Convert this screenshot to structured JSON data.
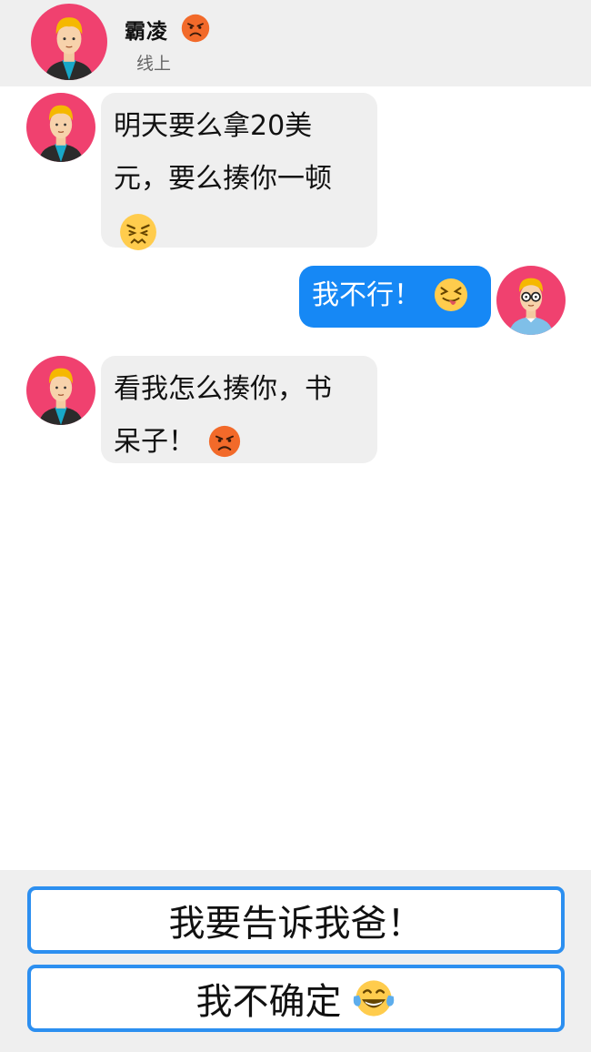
{
  "header": {
    "contact_name": "霸凌",
    "contact_name_emoji": "angry-face-icon",
    "status": "线上"
  },
  "messages": [
    {
      "side": "incoming",
      "avatar": "bully-avatar",
      "lines": [
        "明天要么拿20美",
        "元，要么揍你一顿"
      ],
      "emoji": "persevering-face-icon"
    },
    {
      "side": "outgoing",
      "avatar": "nerd-avatar",
      "lines": [
        "我不行！"
      ],
      "emoji": "tongue-out-squinting-face-icon"
    },
    {
      "side": "incoming",
      "avatar": "bully-avatar",
      "lines": [
        "看我怎么揍你，书",
        "呆子！"
      ],
      "emoji": "angry-face-icon"
    }
  ],
  "choices": [
    {
      "label": "我要告诉我爸！"
    },
    {
      "label": "我不确定",
      "emoji": "tears-of-joy-face-icon"
    }
  ],
  "colors": {
    "header_bg": "#efefef",
    "incoming_bubble": "#efefef",
    "outgoing_bubble": "#1688f5",
    "choice_border": "#2c8ff0",
    "avatar_bg": "#f0416f"
  }
}
